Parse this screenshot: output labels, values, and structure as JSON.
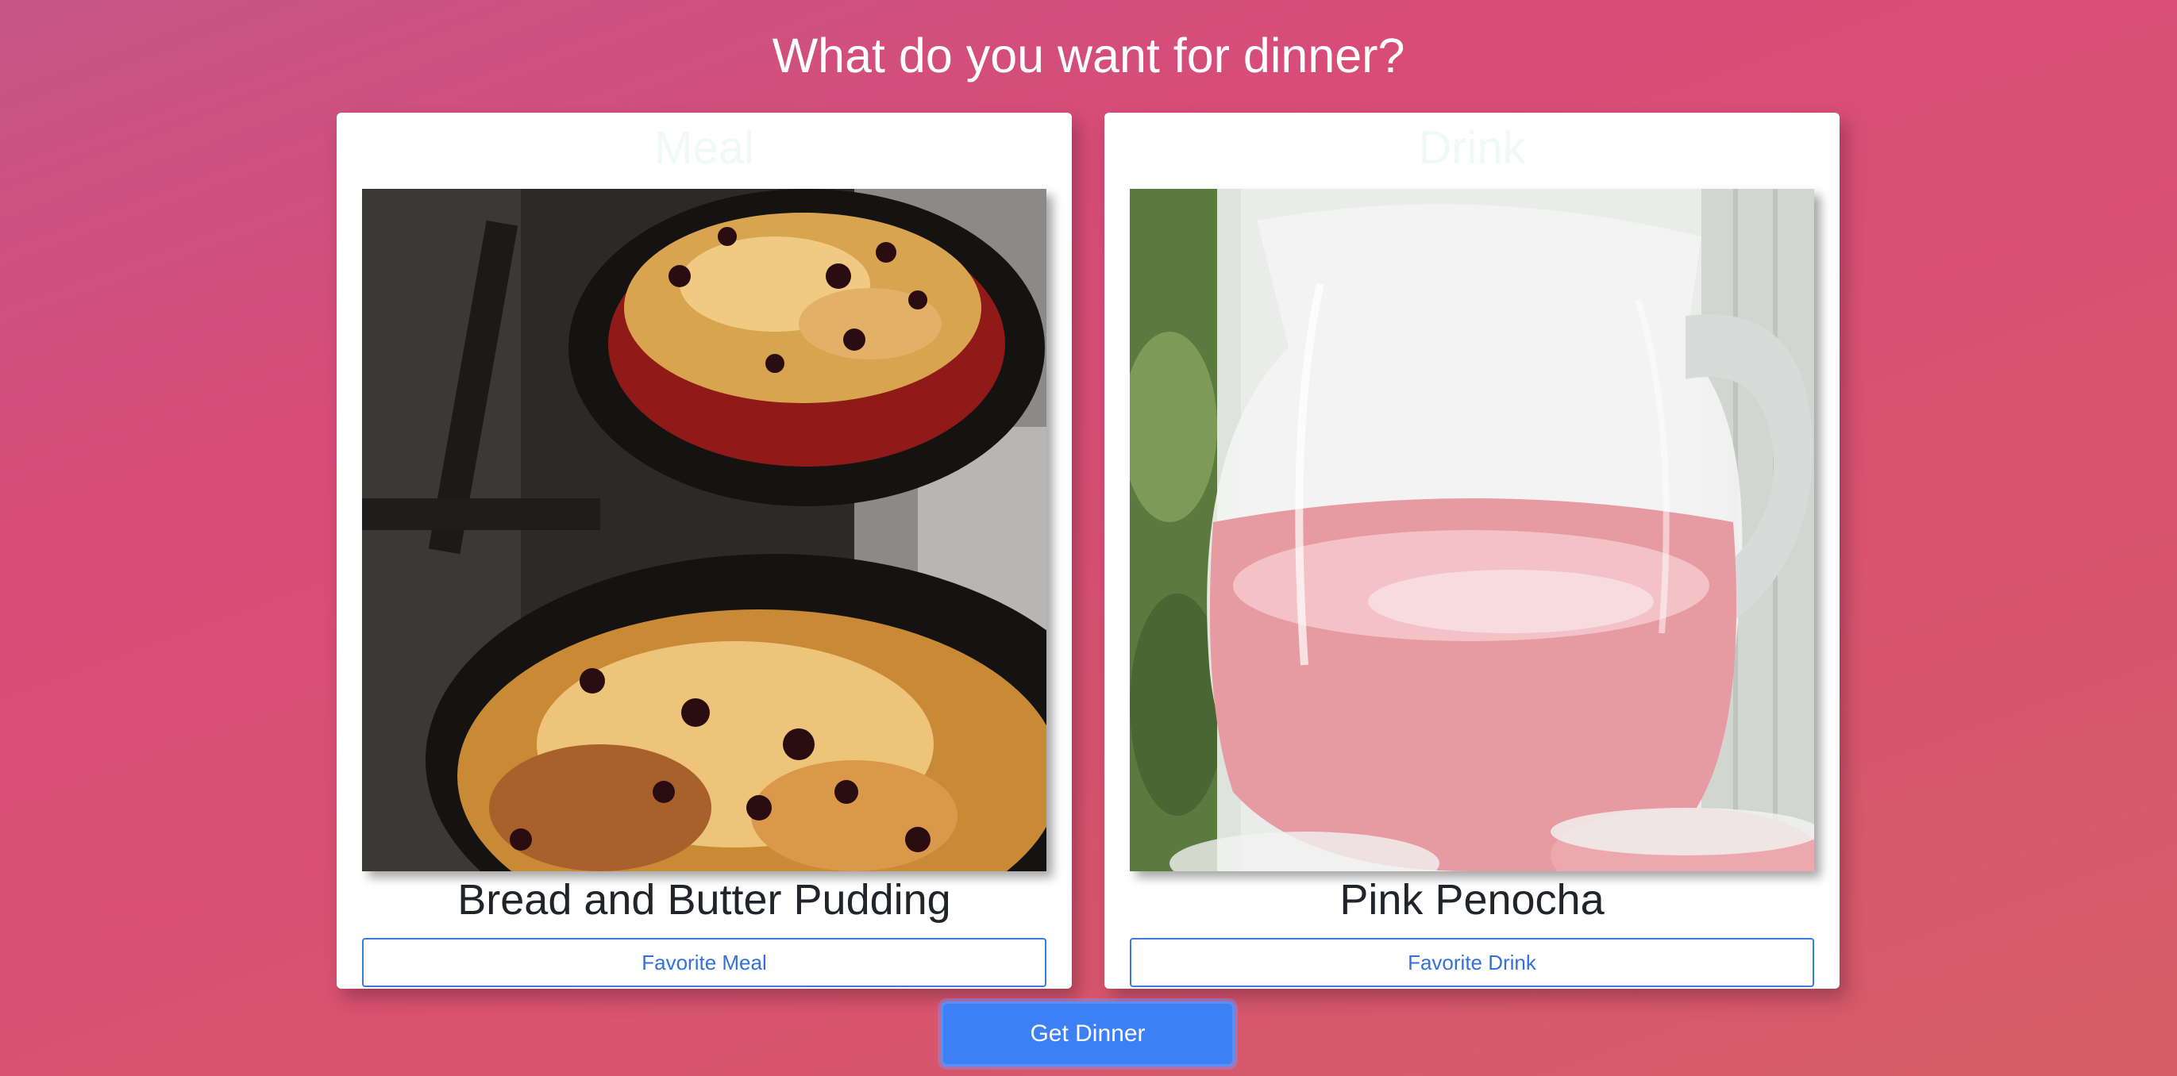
{
  "header": {
    "title": "What do you want for dinner?"
  },
  "meal_card": {
    "header": "Meal",
    "image_icon": "bread-pudding-photo",
    "name": "Bread and Butter Pudding",
    "favorite_label": "Favorite Meal"
  },
  "drink_card": {
    "header": "Drink",
    "image_icon": "pink-drink-pitcher-photo",
    "name": "Pink Penocha",
    "favorite_label": "Favorite Drink"
  },
  "actions": {
    "get_dinner_label": "Get Dinner"
  },
  "colors": {
    "accent": "#3d7ff4",
    "background_gradient_start": "#c55585",
    "background_gradient_end": "#d55d66"
  }
}
